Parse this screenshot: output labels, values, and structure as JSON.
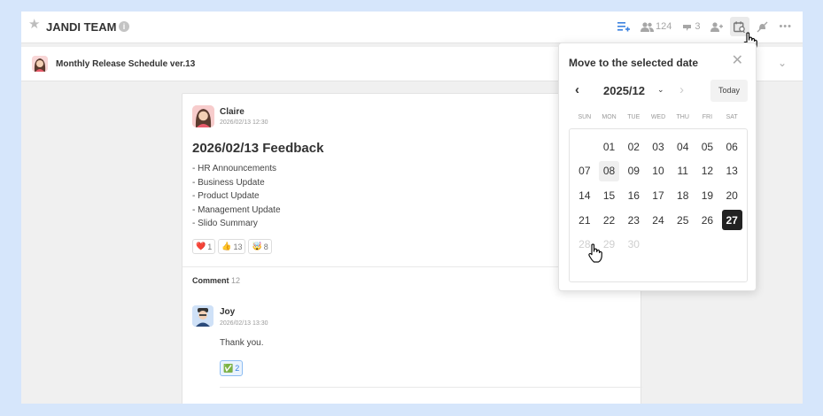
{
  "header": {
    "team_name": "JANDI TEAM",
    "members_count": "124",
    "likes_count": "3",
    "icons": [
      "star-icon",
      "info-icon",
      "list-add-icon",
      "members-icon",
      "pin-icon",
      "add-member-icon",
      "calendar-search-icon",
      "mute-icon",
      "more-icon"
    ]
  },
  "topic": {
    "title": "Monthly Release Schedule ver.13"
  },
  "post": {
    "author": "Claire",
    "time": "2026/02/13 12:30",
    "title": "2026/02/13 Feedback",
    "lines": [
      "- HR Announcements",
      "- Business Update",
      "- Product Update",
      "- Management Update",
      "- Slido Summary"
    ],
    "reactions": [
      {
        "emoji": "❤️",
        "count": "1"
      },
      {
        "emoji": "👍",
        "count": "13"
      },
      {
        "emoji": "🤯",
        "count": "8"
      }
    ]
  },
  "comments": {
    "label": "Comment",
    "count": "12",
    "items": [
      {
        "author": "Joy",
        "time": "2026/02/13 13:30",
        "text": "Thank you.",
        "reaction": {
          "emoji": "✅",
          "count": "2"
        }
      }
    ]
  },
  "date_picker": {
    "title": "Move to the selected date",
    "month": "2025/12",
    "today_label": "Today",
    "weekdays": [
      "SUN",
      "MON",
      "TUE",
      "WED",
      "THU",
      "FRI",
      "SAT"
    ],
    "days": [
      {
        "label": "",
        "state": "empty"
      },
      {
        "label": "01",
        "state": "normal"
      },
      {
        "label": "02",
        "state": "normal"
      },
      {
        "label": "03",
        "state": "normal"
      },
      {
        "label": "04",
        "state": "normal"
      },
      {
        "label": "05",
        "state": "normal"
      },
      {
        "label": "06",
        "state": "normal"
      },
      {
        "label": "07",
        "state": "normal"
      },
      {
        "label": "08",
        "state": "today"
      },
      {
        "label": "09",
        "state": "normal"
      },
      {
        "label": "10",
        "state": "normal"
      },
      {
        "label": "11",
        "state": "normal"
      },
      {
        "label": "12",
        "state": "normal"
      },
      {
        "label": "13",
        "state": "normal"
      },
      {
        "label": "14",
        "state": "normal"
      },
      {
        "label": "15",
        "state": "normal"
      },
      {
        "label": "16",
        "state": "normal"
      },
      {
        "label": "17",
        "state": "normal"
      },
      {
        "label": "18",
        "state": "normal"
      },
      {
        "label": "19",
        "state": "normal"
      },
      {
        "label": "20",
        "state": "normal"
      },
      {
        "label": "21",
        "state": "normal"
      },
      {
        "label": "22",
        "state": "normal"
      },
      {
        "label": "23",
        "state": "normal"
      },
      {
        "label": "24",
        "state": "normal"
      },
      {
        "label": "25",
        "state": "normal"
      },
      {
        "label": "26",
        "state": "normal"
      },
      {
        "label": "27",
        "state": "selected"
      },
      {
        "label": "28",
        "state": "muted"
      },
      {
        "label": "29",
        "state": "muted"
      },
      {
        "label": "30",
        "state": "muted"
      }
    ]
  },
  "colors": {
    "background": "#d6e6fb",
    "accent_blue": "#3b82e0",
    "selected_day": "#222222"
  }
}
